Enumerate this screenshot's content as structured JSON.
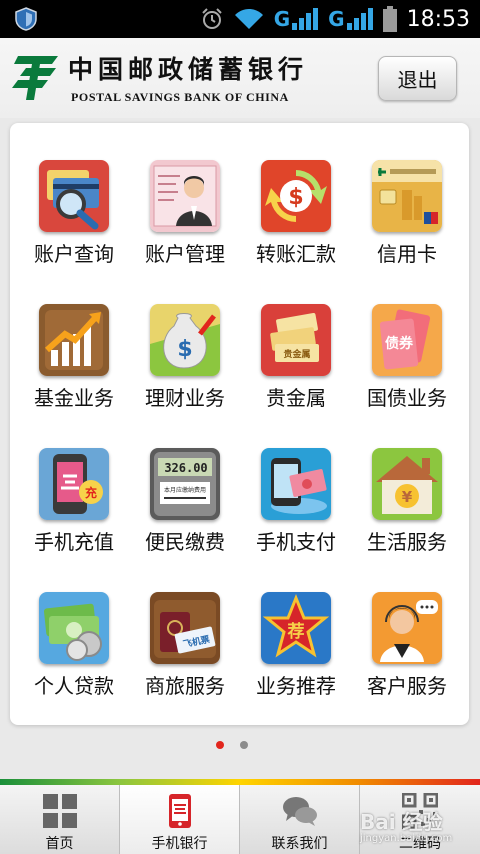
{
  "statusbar": {
    "time": "18:53",
    "network1": "G",
    "network2": "G"
  },
  "header": {
    "bank_name_cn": "中国邮政储蓄银行",
    "bank_name_en": "POSTAL SAVINGS BANK OF CHINA",
    "exit_label": "退出"
  },
  "colors": {
    "brand_green": "#0a7a3c",
    "active_dot": "#e2261d",
    "inactive_dot": "#8c8c8c"
  },
  "menu": {
    "items": [
      {
        "label": "账户查询",
        "icon": "account-query-icon"
      },
      {
        "label": "账户管理",
        "icon": "account-manage-icon"
      },
      {
        "label": "转账汇款",
        "icon": "transfer-icon"
      },
      {
        "label": "信用卡",
        "icon": "credit-card-icon"
      },
      {
        "label": "基金业务",
        "icon": "fund-icon"
      },
      {
        "label": "理财业务",
        "icon": "wealth-icon"
      },
      {
        "label": "贵金属",
        "icon": "precious-metal-icon"
      },
      {
        "label": "国债业务",
        "icon": "bond-icon"
      },
      {
        "label": "手机充值",
        "icon": "phone-recharge-icon"
      },
      {
        "label": "便民缴费",
        "icon": "bill-pay-icon"
      },
      {
        "label": "手机支付",
        "icon": "mobile-pay-icon"
      },
      {
        "label": "生活服务",
        "icon": "life-service-icon"
      },
      {
        "label": "个人贷款",
        "icon": "loan-icon"
      },
      {
        "label": "商旅服务",
        "icon": "travel-icon"
      },
      {
        "label": "业务推荐",
        "icon": "recommend-icon"
      },
      {
        "label": "客户服务",
        "icon": "customer-service-icon"
      }
    ],
    "bill_amount": "326.00",
    "bill_caption": "本月应缴纳费用",
    "ticket_text": "飞机票",
    "recommend_char": "荐",
    "bond_char": "债券",
    "gold_text": "贵金属"
  },
  "pager": {
    "current": 1,
    "total": 2
  },
  "bottomnav": {
    "items": [
      {
        "label": "首页",
        "icon": "home-grid-icon"
      },
      {
        "label": "手机银行",
        "icon": "mobile-bank-icon"
      },
      {
        "label": "联系我们",
        "icon": "chat-bubbles-icon"
      },
      {
        "label": "二维码",
        "icon": "qr-code-icon"
      }
    ]
  },
  "watermark": {
    "text": "Bai 经验",
    "sub": "jingyan.baidu.com"
  }
}
